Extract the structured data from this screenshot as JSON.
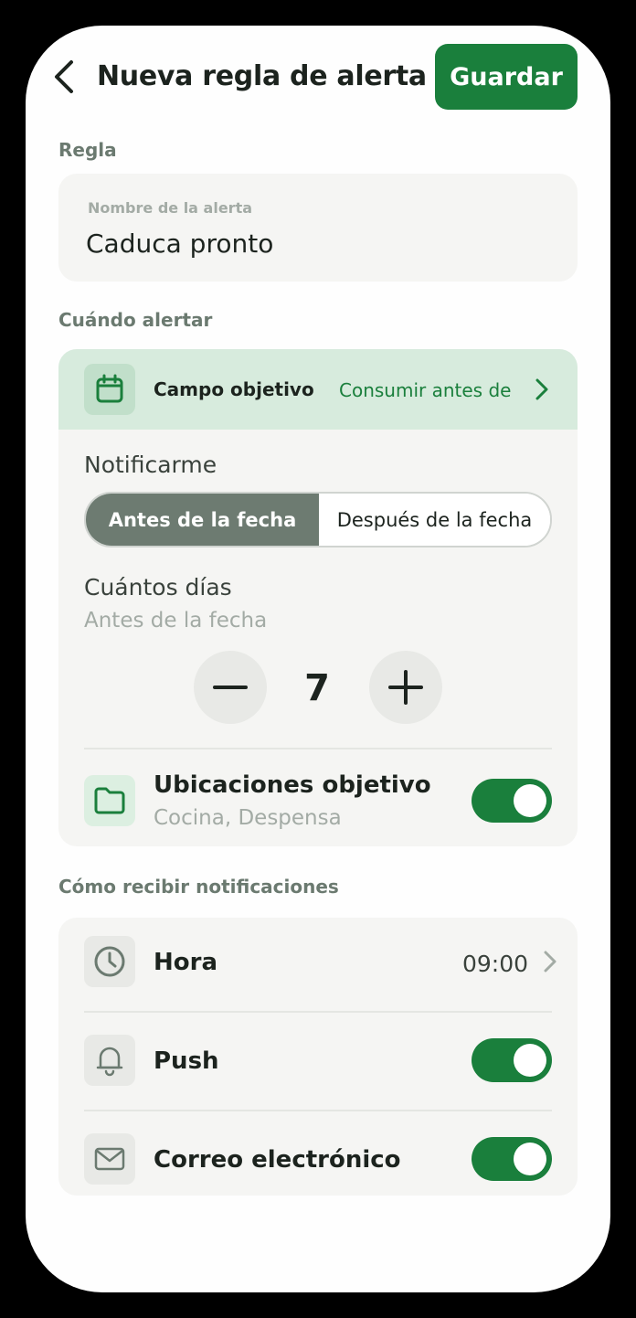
{
  "header": {
    "title": "Nueva regla de alerta",
    "save_label": "Guardar"
  },
  "sections": {
    "rule": "Regla",
    "when": "Cuándo alertar",
    "how": "Cómo recibir notificaciones"
  },
  "rule": {
    "name_label": "Nombre de la alerta",
    "name_value": "Caduca pronto"
  },
  "when": {
    "target_field_label": "Campo objetivo",
    "target_field_value": "Consumir antes de",
    "notify_label": "Notificarme",
    "options": [
      "Antes de la fecha",
      "Después de la fecha"
    ],
    "selected_option": "Antes de la fecha",
    "days_label": "Cuántos días",
    "days_sublabel": "Antes de la fecha",
    "days_value": "7",
    "locations_label": "Ubicaciones objetivo",
    "locations_value": "Cocina, Despensa",
    "locations_enabled": true
  },
  "how": {
    "time_label": "Hora",
    "time_value": "09:00",
    "push_label": "Push",
    "push_enabled": true,
    "email_label": "Correo electrónico",
    "email_enabled": true
  },
  "colors": {
    "accent": "#1a7f3c",
    "accent_light": "#d7ebdd",
    "segment_active": "#6d7b71",
    "card_bg": "#f5f5f3"
  },
  "icons": {
    "back": "chevron-left-icon",
    "target": "calendar-icon",
    "locations": "folder-icon",
    "time": "clock-icon",
    "push": "bell-icon",
    "email": "mail-icon"
  }
}
